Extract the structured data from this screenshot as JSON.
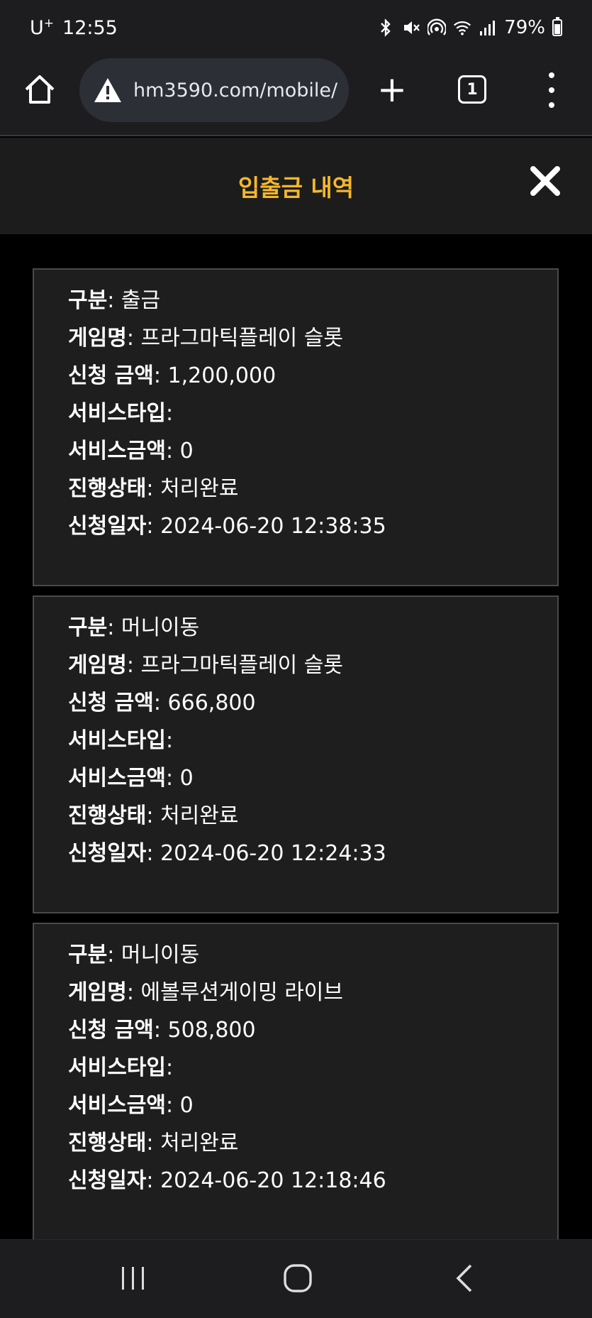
{
  "status_bar": {
    "carrier": "U",
    "carrier_sup": "+",
    "time": "12:55",
    "battery": "79%"
  },
  "browser": {
    "url": "hm3590.com/mobile/",
    "tab_count": "1",
    "new_tab_symbol": "+"
  },
  "header": {
    "title": "입출금 내역"
  },
  "labels": {
    "category": "구분",
    "game_name": "게임명",
    "request_amount": "신청 금액",
    "service_type": "서비스타입",
    "service_amount": "서비스금액",
    "status": "진행상태",
    "request_date": "신청일자"
  },
  "records": [
    {
      "category": "출금",
      "game_name": "프라그마틱플레이 슬롯",
      "request_amount": "1,200,000",
      "service_type": "",
      "service_amount": "0",
      "status": "처리완료",
      "request_date": "2024-06-20 12:38:35"
    },
    {
      "category": "머니이동",
      "game_name": "프라그마틱플레이 슬롯",
      "request_amount": "666,800",
      "service_type": "",
      "service_amount": "0",
      "status": "처리완료",
      "request_date": "2024-06-20 12:24:33"
    },
    {
      "category": "머니이동",
      "game_name": "에볼루션게이밍 라이브",
      "request_amount": "508,800",
      "service_type": "",
      "service_amount": "0",
      "status": "처리완료",
      "request_date": "2024-06-20 12:18:46"
    }
  ],
  "colors": {
    "title_accent": "#f5b72b",
    "card_bg": "#1e1e1e",
    "card_border": "#4a4a4a"
  }
}
